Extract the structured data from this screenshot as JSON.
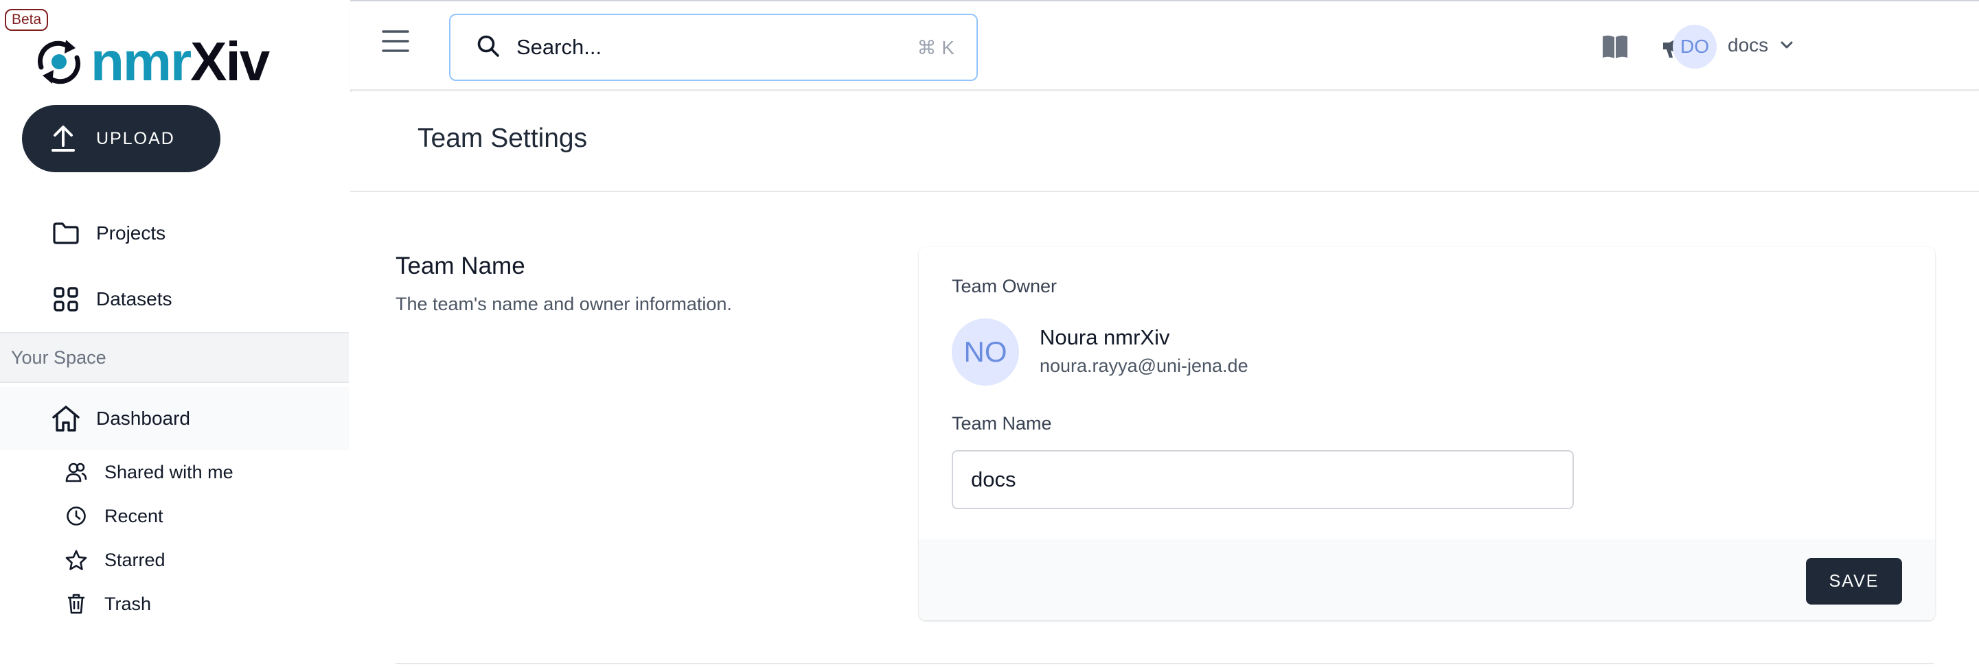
{
  "sidebar": {
    "beta_label": "Beta",
    "logo": {
      "part1": "nmr",
      "part2": "Xiv"
    },
    "upload_label": "UPLOAD",
    "nav": [
      {
        "label": "Projects",
        "icon": "folder-icon"
      },
      {
        "label": "Datasets",
        "icon": "grid-icon"
      }
    ],
    "section_label": "Your Space",
    "dashboard_label": "Dashboard",
    "sub_items": [
      {
        "label": "Shared with me",
        "icon": "users-icon"
      },
      {
        "label": "Recent",
        "icon": "clock-icon"
      },
      {
        "label": "Starred",
        "icon": "star-icon"
      },
      {
        "label": "Trash",
        "icon": "trash-icon"
      }
    ]
  },
  "topbar": {
    "search_placeholder": "Search...",
    "search_shortcut": "⌘ K",
    "icons": [
      "book-icon",
      "megaphone-icon"
    ],
    "avatar_initials": "DO",
    "team_name": "docs"
  },
  "page": {
    "title": "Team Settings"
  },
  "team_section": {
    "title": "Team Name",
    "description": "The team's name and owner information.",
    "owner_label": "Team Owner",
    "owner_initials": "NO",
    "owner_name": "Noura nmrXiv",
    "owner_email": "noura.rayya@uni-jena.de",
    "name_label": "Team Name",
    "name_value": "docs",
    "save_label": "SAVE"
  },
  "colors": {
    "accent_dark": "#1f2937",
    "logo_blue": "#1497b8",
    "avatar_bg": "#e0e7ff"
  }
}
